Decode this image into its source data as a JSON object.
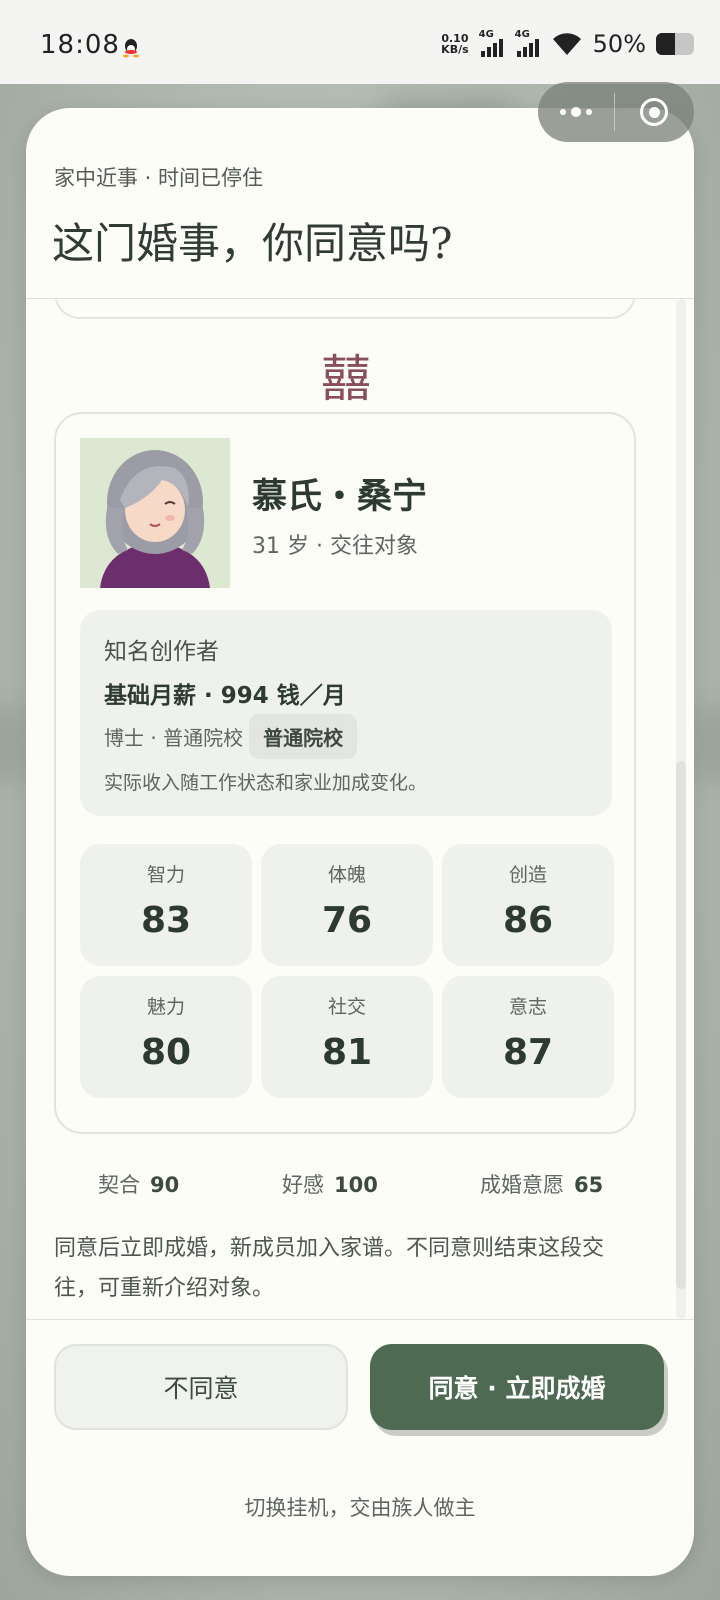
{
  "status_bar": {
    "time": "18:08",
    "net_speed_value": "0.10",
    "net_speed_unit": "KB/s",
    "signal_1_label": "4G",
    "signal_2_label": "4G",
    "battery": "50%",
    "battery_level": 0.5
  },
  "header": {
    "subtitle": "家中近事 · 时间已停住",
    "title": "这门婚事，你同意吗?"
  },
  "decoration": {
    "double_happiness": "囍"
  },
  "candidate": {
    "name": "慕氏・桑宁",
    "meta": "31 岁 · 交往对象",
    "job": {
      "title": "知名创作者",
      "salary": "基础月薪 · 994 钱／月",
      "education_text": "博士 · 普通院校",
      "education_tag": "普通院校",
      "note": "实际收入随工作状态和家业加成变化。"
    },
    "stats": [
      {
        "label": "智力",
        "value": "83"
      },
      {
        "label": "体魄",
        "value": "76"
      },
      {
        "label": "创造",
        "value": "86"
      },
      {
        "label": "魅力",
        "value": "80"
      },
      {
        "label": "社交",
        "value": "81"
      },
      {
        "label": "意志",
        "value": "87"
      }
    ]
  },
  "relationship": {
    "fit_label": "契合",
    "fit_value": "90",
    "affection_label": "好感",
    "affection_value": "100",
    "willing_label": "成婚意愿",
    "willing_value": "65"
  },
  "description": "同意后立即成婚，新成员加入家谱。不同意则结束这段交往，可重新介绍对象。",
  "actions": {
    "reject": "不同意",
    "accept": "同意 · 立即成婚",
    "auto_mode": "切换挂机，交由族人做主"
  },
  "colors": {
    "primary": "#4e6a53",
    "accent_red": "#8a4d5c",
    "card_bg": "#fdfdf8",
    "muted_bg": "#eff1ec"
  },
  "icons": [
    "qq-icon",
    "signal-icon",
    "wifi-icon",
    "battery-icon",
    "more-icon",
    "close-miniapp-icon"
  ]
}
